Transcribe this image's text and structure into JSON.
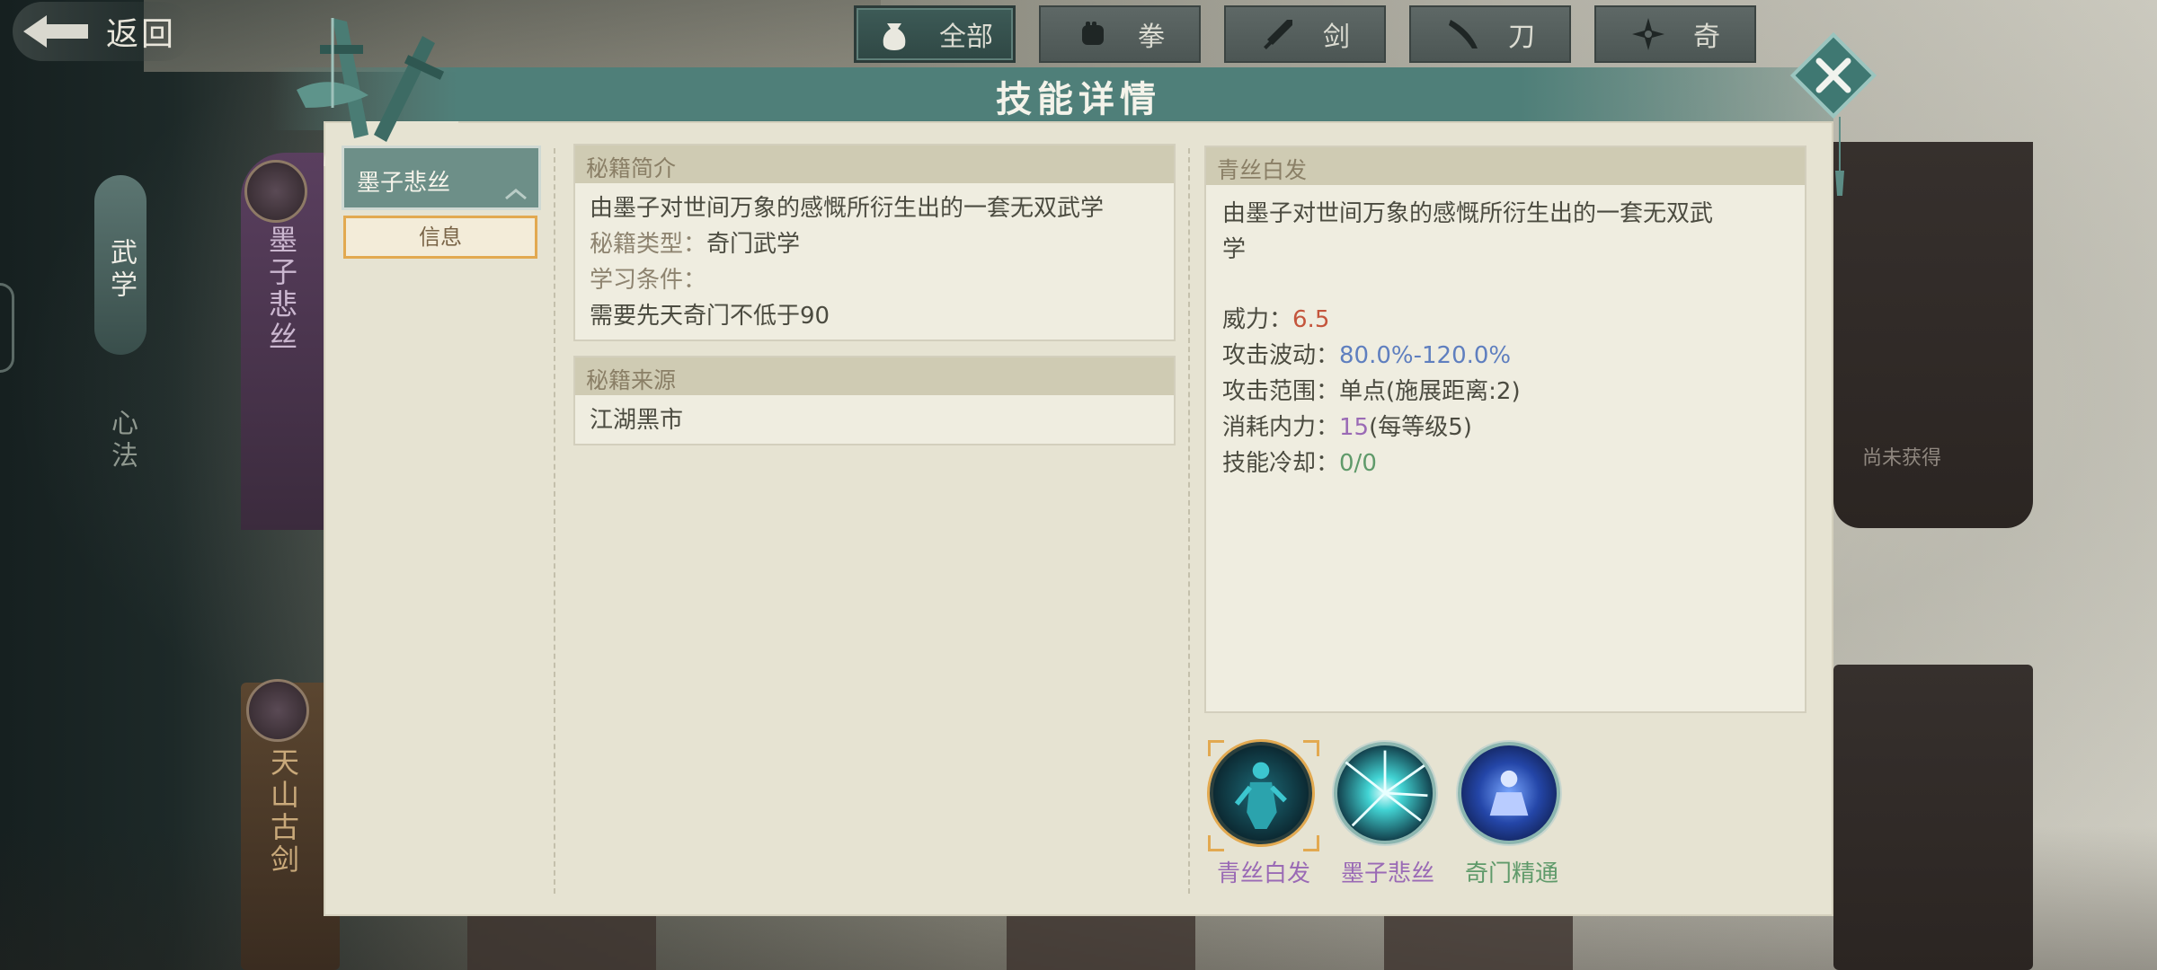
{
  "header": {
    "back_label": "返回",
    "title": "技能详情"
  },
  "filter_tabs": [
    {
      "label": "全部",
      "icon": "bag-icon",
      "active": true
    },
    {
      "label": "拳",
      "icon": "fist-icon",
      "active": false
    },
    {
      "label": "剑",
      "icon": "sword-icon",
      "active": false
    },
    {
      "label": "刀",
      "icon": "blade-icon",
      "active": false
    },
    {
      "label": "奇",
      "icon": "shuriken-icon",
      "active": false
    }
  ],
  "left_nav": [
    {
      "label": "武学",
      "active": true
    },
    {
      "label": "心法",
      "active": false
    }
  ],
  "background": {
    "card_purple_title": "墨子悲丝",
    "card_brown_title": "天山古剑",
    "not_obtained": "尚未获得"
  },
  "skill_list": {
    "selected_item": "墨子悲丝",
    "info_button": "信息"
  },
  "intro": {
    "header": "秘籍简介",
    "description": "由墨子对世间万象的感慨所衍生出的一套无双武学",
    "type_label": "秘籍类型：",
    "type_value": "奇门武学",
    "req_label": "学习条件：",
    "req_value": "需要先天奇门不低于90"
  },
  "source": {
    "header": "秘籍来源",
    "value": "江湖黑市"
  },
  "detail": {
    "header": "青丝白发",
    "description_line1": "由墨子对世间万象的感慨所衍生出的一套无双武",
    "description_line2": "学",
    "power_label": "威力：",
    "power_value": "6.5",
    "wave_label": "攻击波动：",
    "wave_value": "80.0%-120.0%",
    "range_label": "攻击范围：",
    "range_value": "单点(施展距离:2)",
    "cost_label": "消耗内力：",
    "cost_value": "15",
    "cost_extra": "(每等级5)",
    "cd_label": "技能冷却：",
    "cd_value": "0/0"
  },
  "skills": [
    {
      "name": "青丝白发",
      "color": "#9a6ab5",
      "selected": true
    },
    {
      "name": "墨子悲丝",
      "color": "#9a6ab5",
      "selected": false
    },
    {
      "name": "奇门精通",
      "color": "#5f9a6a",
      "selected": false
    }
  ],
  "colors": {
    "accent_teal": "#4f7f79",
    "panel_bg": "#e6e3d2",
    "highlight_orange": "#e2a950"
  }
}
